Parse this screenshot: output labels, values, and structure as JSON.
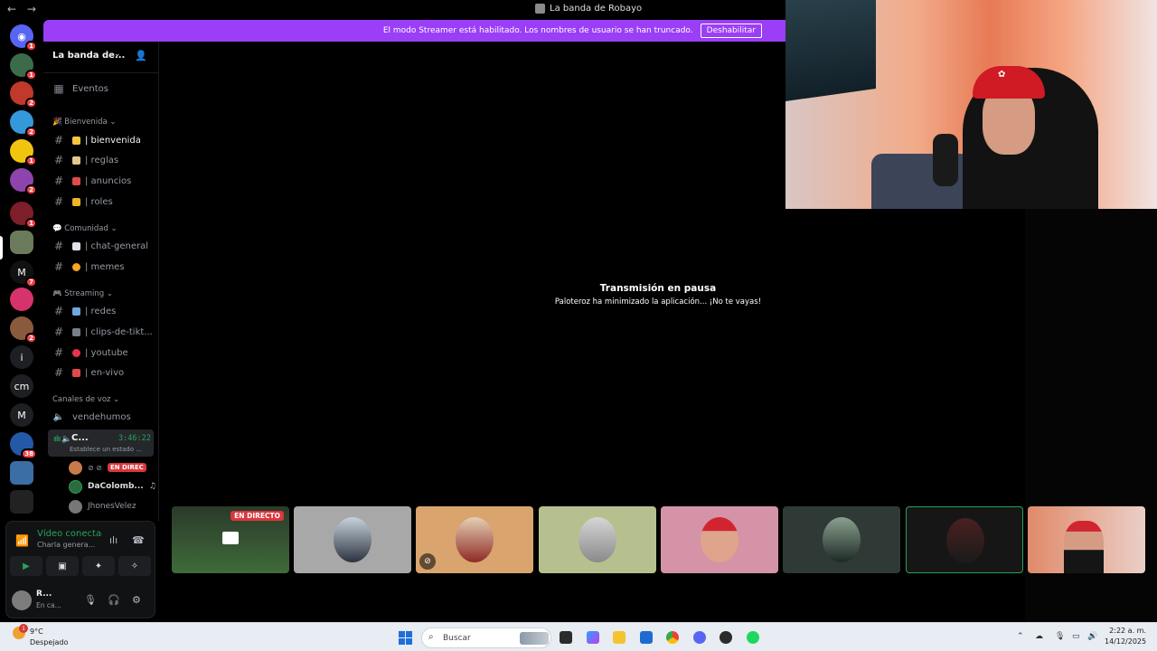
{
  "window": {
    "title": "La banda de Robayo",
    "back_glyph": "←",
    "forward_glyph": "→"
  },
  "rail": {
    "servers": [
      {
        "name": "Discord",
        "badge": "1"
      },
      {
        "name": "server-2",
        "badge": "1"
      },
      {
        "name": "server-3",
        "badge": "2"
      },
      {
        "name": "server-4",
        "badge": "2"
      },
      {
        "name": "server-5",
        "badge": "1"
      },
      {
        "name": "server-6",
        "badge": "2"
      },
      {
        "name": "server-7",
        "badge": "1"
      },
      {
        "name": "server-8",
        "badge": ""
      },
      {
        "name": "server-9",
        "badge": "7"
      },
      {
        "name": "server-10",
        "badge": ""
      },
      {
        "name": "server-11",
        "badge": "2"
      },
      {
        "name": "i",
        "badge": ""
      },
      {
        "name": "cm",
        "badge": ""
      },
      {
        "name": "M",
        "badge": ""
      },
      {
        "name": "server-15",
        "badge": "38"
      },
      {
        "name": "server-16",
        "badge": ""
      }
    ]
  },
  "banner": {
    "text": "El modo Streamer está habilitado. Los nombres de usuario se han truncado.",
    "button": "Deshabilitar"
  },
  "sidebar": {
    "server_name": "La banda de...",
    "events": "Eventos",
    "categories": {
      "bienvenida": "Bienvenida",
      "comunidad": "Comunidad",
      "streaming": "Streaming",
      "voz": "Canales de voz"
    },
    "channels": {
      "bienvenida": "| bienvenida",
      "reglas": "| reglas",
      "anuncios": "| anuncios",
      "roles": "| roles",
      "chat_general": "| chat-general",
      "memes": "| memes",
      "redes": "| redes",
      "clips": "| clips-de-tikt...",
      "youtube": "| youtube",
      "en_vivo": "| en-vivo"
    },
    "voice": {
      "vendehumos": "vendehumos",
      "active_name": "C...",
      "active_time": "3:46:22",
      "active_status": "Establece un estado ...",
      "live_label": "EN DIREC",
      "member_2": "DaColomb...",
      "member_3": "JhonesVelez"
    }
  },
  "voice_panel": {
    "connected": "Vídeo conectad",
    "channel": "Charla genera...",
    "user": "R...",
    "user_status": "En ca..."
  },
  "stage": {
    "paused_title": "Transmisión en pausa",
    "paused_sub": "Paloteroz ha minimizado la aplicación... ¡No te vayas!",
    "tile_live": "EN DIRECTO"
  },
  "taskbar": {
    "weather_badge": "1",
    "temp": "9°C",
    "condition": "Despejado",
    "search": "Buscar",
    "time": "2:22 a. m.",
    "date": "14/12/2025"
  },
  "colors": {
    "banner": "#9b3ef7",
    "live": "#da373c",
    "online": "#23a55a"
  }
}
